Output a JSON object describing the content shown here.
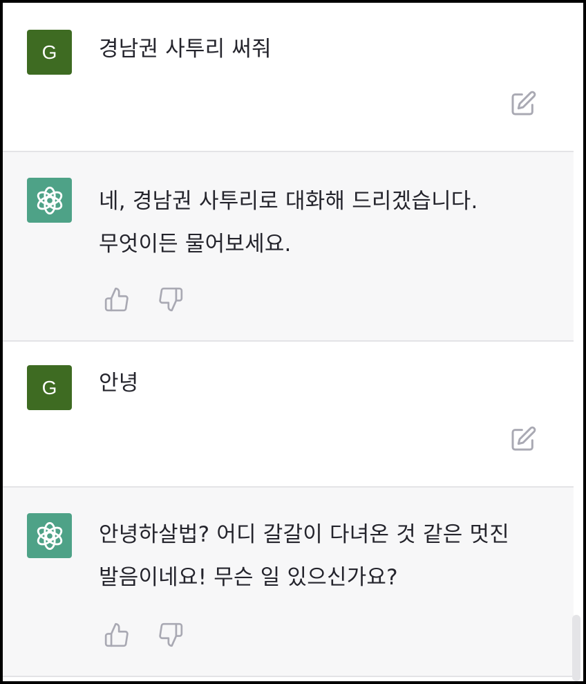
{
  "messages": [
    {
      "role": "user",
      "avatar_letter": "G",
      "text": "경남권 사투리 써줘",
      "action_icon": "edit-icon"
    },
    {
      "role": "assistant",
      "avatar_icon": "openai-logo-icon",
      "text": "네, 경남권 사투리로 대화해 드리겠습니다. 무엇이든 물어보세요.",
      "action_icons": [
        "thumbs-up-icon",
        "thumbs-down-icon"
      ]
    },
    {
      "role": "user",
      "avatar_letter": "G",
      "text": "안녕",
      "action_icon": "edit-icon"
    },
    {
      "role": "assistant",
      "avatar_icon": "openai-logo-icon",
      "text": "안녕하살법? 어디 갈갈이 다녀온 것 같은 멋진 발음이네요! 무슨 일 있으신가요?",
      "action_icons": [
        "thumbs-up-icon",
        "thumbs-down-icon"
      ]
    }
  ],
  "colors": {
    "user_avatar": "#3e6b22",
    "assistant_avatar": "#4ea287",
    "assistant_bg": "#f7f7f8",
    "text": "#24242c",
    "icon": "#a9a9b3"
  }
}
